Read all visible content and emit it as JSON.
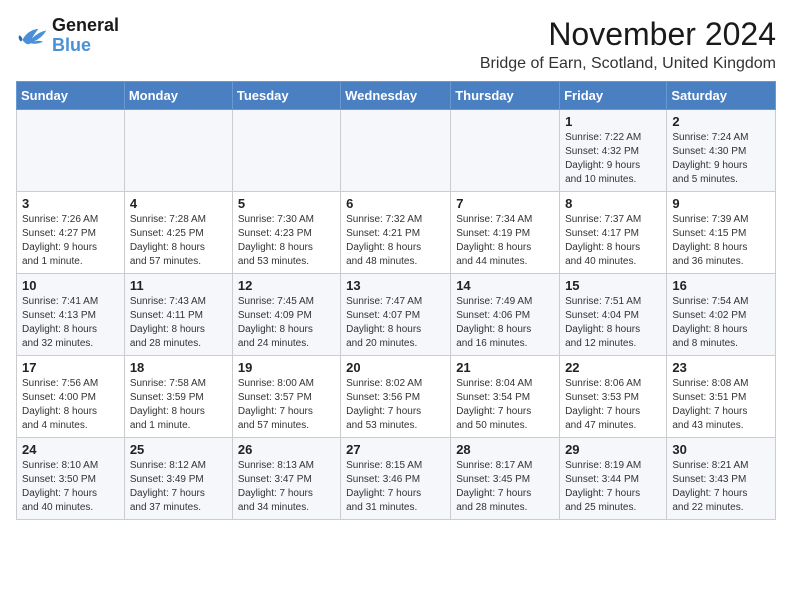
{
  "logo": {
    "line1": "General",
    "line2": "Blue"
  },
  "title": "November 2024",
  "location": "Bridge of Earn, Scotland, United Kingdom",
  "days_of_week": [
    "Sunday",
    "Monday",
    "Tuesday",
    "Wednesday",
    "Thursday",
    "Friday",
    "Saturday"
  ],
  "weeks": [
    [
      {
        "day": "",
        "info": ""
      },
      {
        "day": "",
        "info": ""
      },
      {
        "day": "",
        "info": ""
      },
      {
        "day": "",
        "info": ""
      },
      {
        "day": "",
        "info": ""
      },
      {
        "day": "1",
        "info": "Sunrise: 7:22 AM\nSunset: 4:32 PM\nDaylight: 9 hours\nand 10 minutes."
      },
      {
        "day": "2",
        "info": "Sunrise: 7:24 AM\nSunset: 4:30 PM\nDaylight: 9 hours\nand 5 minutes."
      }
    ],
    [
      {
        "day": "3",
        "info": "Sunrise: 7:26 AM\nSunset: 4:27 PM\nDaylight: 9 hours\nand 1 minute."
      },
      {
        "day": "4",
        "info": "Sunrise: 7:28 AM\nSunset: 4:25 PM\nDaylight: 8 hours\nand 57 minutes."
      },
      {
        "day": "5",
        "info": "Sunrise: 7:30 AM\nSunset: 4:23 PM\nDaylight: 8 hours\nand 53 minutes."
      },
      {
        "day": "6",
        "info": "Sunrise: 7:32 AM\nSunset: 4:21 PM\nDaylight: 8 hours\nand 48 minutes."
      },
      {
        "day": "7",
        "info": "Sunrise: 7:34 AM\nSunset: 4:19 PM\nDaylight: 8 hours\nand 44 minutes."
      },
      {
        "day": "8",
        "info": "Sunrise: 7:37 AM\nSunset: 4:17 PM\nDaylight: 8 hours\nand 40 minutes."
      },
      {
        "day": "9",
        "info": "Sunrise: 7:39 AM\nSunset: 4:15 PM\nDaylight: 8 hours\nand 36 minutes."
      }
    ],
    [
      {
        "day": "10",
        "info": "Sunrise: 7:41 AM\nSunset: 4:13 PM\nDaylight: 8 hours\nand 32 minutes."
      },
      {
        "day": "11",
        "info": "Sunrise: 7:43 AM\nSunset: 4:11 PM\nDaylight: 8 hours\nand 28 minutes."
      },
      {
        "day": "12",
        "info": "Sunrise: 7:45 AM\nSunset: 4:09 PM\nDaylight: 8 hours\nand 24 minutes."
      },
      {
        "day": "13",
        "info": "Sunrise: 7:47 AM\nSunset: 4:07 PM\nDaylight: 8 hours\nand 20 minutes."
      },
      {
        "day": "14",
        "info": "Sunrise: 7:49 AM\nSunset: 4:06 PM\nDaylight: 8 hours\nand 16 minutes."
      },
      {
        "day": "15",
        "info": "Sunrise: 7:51 AM\nSunset: 4:04 PM\nDaylight: 8 hours\nand 12 minutes."
      },
      {
        "day": "16",
        "info": "Sunrise: 7:54 AM\nSunset: 4:02 PM\nDaylight: 8 hours\nand 8 minutes."
      }
    ],
    [
      {
        "day": "17",
        "info": "Sunrise: 7:56 AM\nSunset: 4:00 PM\nDaylight: 8 hours\nand 4 minutes."
      },
      {
        "day": "18",
        "info": "Sunrise: 7:58 AM\nSunset: 3:59 PM\nDaylight: 8 hours\nand 1 minute."
      },
      {
        "day": "19",
        "info": "Sunrise: 8:00 AM\nSunset: 3:57 PM\nDaylight: 7 hours\nand 57 minutes."
      },
      {
        "day": "20",
        "info": "Sunrise: 8:02 AM\nSunset: 3:56 PM\nDaylight: 7 hours\nand 53 minutes."
      },
      {
        "day": "21",
        "info": "Sunrise: 8:04 AM\nSunset: 3:54 PM\nDaylight: 7 hours\nand 50 minutes."
      },
      {
        "day": "22",
        "info": "Sunrise: 8:06 AM\nSunset: 3:53 PM\nDaylight: 7 hours\nand 47 minutes."
      },
      {
        "day": "23",
        "info": "Sunrise: 8:08 AM\nSunset: 3:51 PM\nDaylight: 7 hours\nand 43 minutes."
      }
    ],
    [
      {
        "day": "24",
        "info": "Sunrise: 8:10 AM\nSunset: 3:50 PM\nDaylight: 7 hours\nand 40 minutes."
      },
      {
        "day": "25",
        "info": "Sunrise: 8:12 AM\nSunset: 3:49 PM\nDaylight: 7 hours\nand 37 minutes."
      },
      {
        "day": "26",
        "info": "Sunrise: 8:13 AM\nSunset: 3:47 PM\nDaylight: 7 hours\nand 34 minutes."
      },
      {
        "day": "27",
        "info": "Sunrise: 8:15 AM\nSunset: 3:46 PM\nDaylight: 7 hours\nand 31 minutes."
      },
      {
        "day": "28",
        "info": "Sunrise: 8:17 AM\nSunset: 3:45 PM\nDaylight: 7 hours\nand 28 minutes."
      },
      {
        "day": "29",
        "info": "Sunrise: 8:19 AM\nSunset: 3:44 PM\nDaylight: 7 hours\nand 25 minutes."
      },
      {
        "day": "30",
        "info": "Sunrise: 8:21 AM\nSunset: 3:43 PM\nDaylight: 7 hours\nand 22 minutes."
      }
    ]
  ]
}
